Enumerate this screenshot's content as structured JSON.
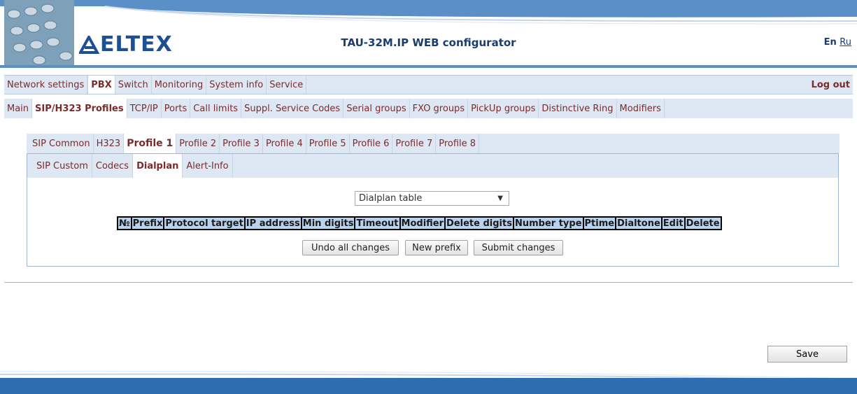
{
  "header": {
    "logo_text": "ELTEX",
    "app_title": "TAU-32M.IP WEB configurator",
    "lang_en": "En",
    "lang_ru": "Ru",
    "accent_color": "#5b8fc7"
  },
  "main_menu": {
    "items": [
      "Network settings",
      "PBX",
      "Switch",
      "Monitoring",
      "System info",
      "Service"
    ],
    "active": "PBX",
    "logout": "Log out"
  },
  "pbx_menu": {
    "items": [
      "Main",
      "SIP/H323 Profiles",
      "TCP/IP",
      "Ports",
      "Call limits",
      "Suppl. Service Codes",
      "Serial groups",
      "FXO groups",
      "PickUp groups",
      "Distinctive Ring",
      "Modifiers"
    ],
    "active": "SIP/H323 Profiles"
  },
  "profile_tabs": {
    "items": [
      "SIP Common",
      "H323",
      "Profile 1",
      "Profile 2",
      "Profile 3",
      "Profile 4",
      "Profile 5",
      "Profile 6",
      "Profile 7",
      "Profile 8"
    ],
    "active": "Profile 1"
  },
  "sub_tabs": {
    "items": [
      "SIP Custom",
      "Codecs",
      "Dialplan",
      "Alert-Info"
    ],
    "active": "Dialplan"
  },
  "dialplan": {
    "select_value": "Dialplan table",
    "columns": [
      "№",
      "Prefix",
      "Protocol target",
      "IP address",
      "Min digits",
      "Timeout",
      "Modifier",
      "Delete digits",
      "Number type",
      "Ptime",
      "Dialtone",
      "Edit",
      "Delete"
    ],
    "buttons": {
      "undo": "Undo all changes",
      "new_prefix": "New prefix",
      "submit": "Submit changes"
    }
  },
  "save_label": "Save"
}
